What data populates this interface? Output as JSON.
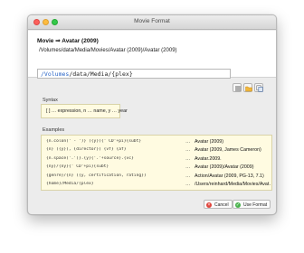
{
  "window": {
    "title": "Movie Format"
  },
  "header": {
    "title": "Movie ⇒ Avatar (2009)",
    "path": "/Volumes/data/Media/Movies/Avatar (2009)/Avatar (2009)"
  },
  "expression": {
    "part1": "/Volumes",
    "part2": "/data/Media/",
    "part3": "{plex}"
  },
  "syntax": {
    "label": "Syntax",
    "text": "[ ] … expression, n … name, y … year"
  },
  "examples": {
    "label": "Examples",
    "rows": [
      {
        "code": "{n.colon(' - ')} ({y}){' CD'+pi}{subt}",
        "dots": "…",
        "result": "Avatar (2009)"
      },
      {
        "code": "{n} ({y}), {director}) {vf} {af}",
        "dots": "…",
        "result": "Avatar (2009, James Cameron)"
      },
      {
        "code": "{n.space('.')}.{y}{'.'+source}.{vc}",
        "dots": "…",
        "result": "Avatar.2009."
      },
      {
        "code": "{ny}/{ny}{' CD'+pi}{subt}",
        "dots": "…",
        "result": "Avatar (2009)/Avatar (2009)"
      },
      {
        "code": "{genre}/{n} ({y, certification, rating})",
        "dots": "…",
        "result": "Action/Avatar (2009, PG-13, 7.1)"
      },
      {
        "code": "{home}/Media/{plex}",
        "dots": "…",
        "result": "/Users/reinhard/Media/Movies/Avat…"
      }
    ]
  },
  "buttons": {
    "cancel": "Cancel",
    "use": "Use Format"
  },
  "icons": {
    "menu": "list-icon",
    "folder": "folder-icon",
    "copy": "copy-icon",
    "cancel": "cancel-icon",
    "use": "checkmark-icon"
  },
  "colors": {
    "accent": "#2a66c8",
    "hint_bg": "#fffbe1",
    "cancel": "#e0463d",
    "ok": "#4bb34e"
  }
}
